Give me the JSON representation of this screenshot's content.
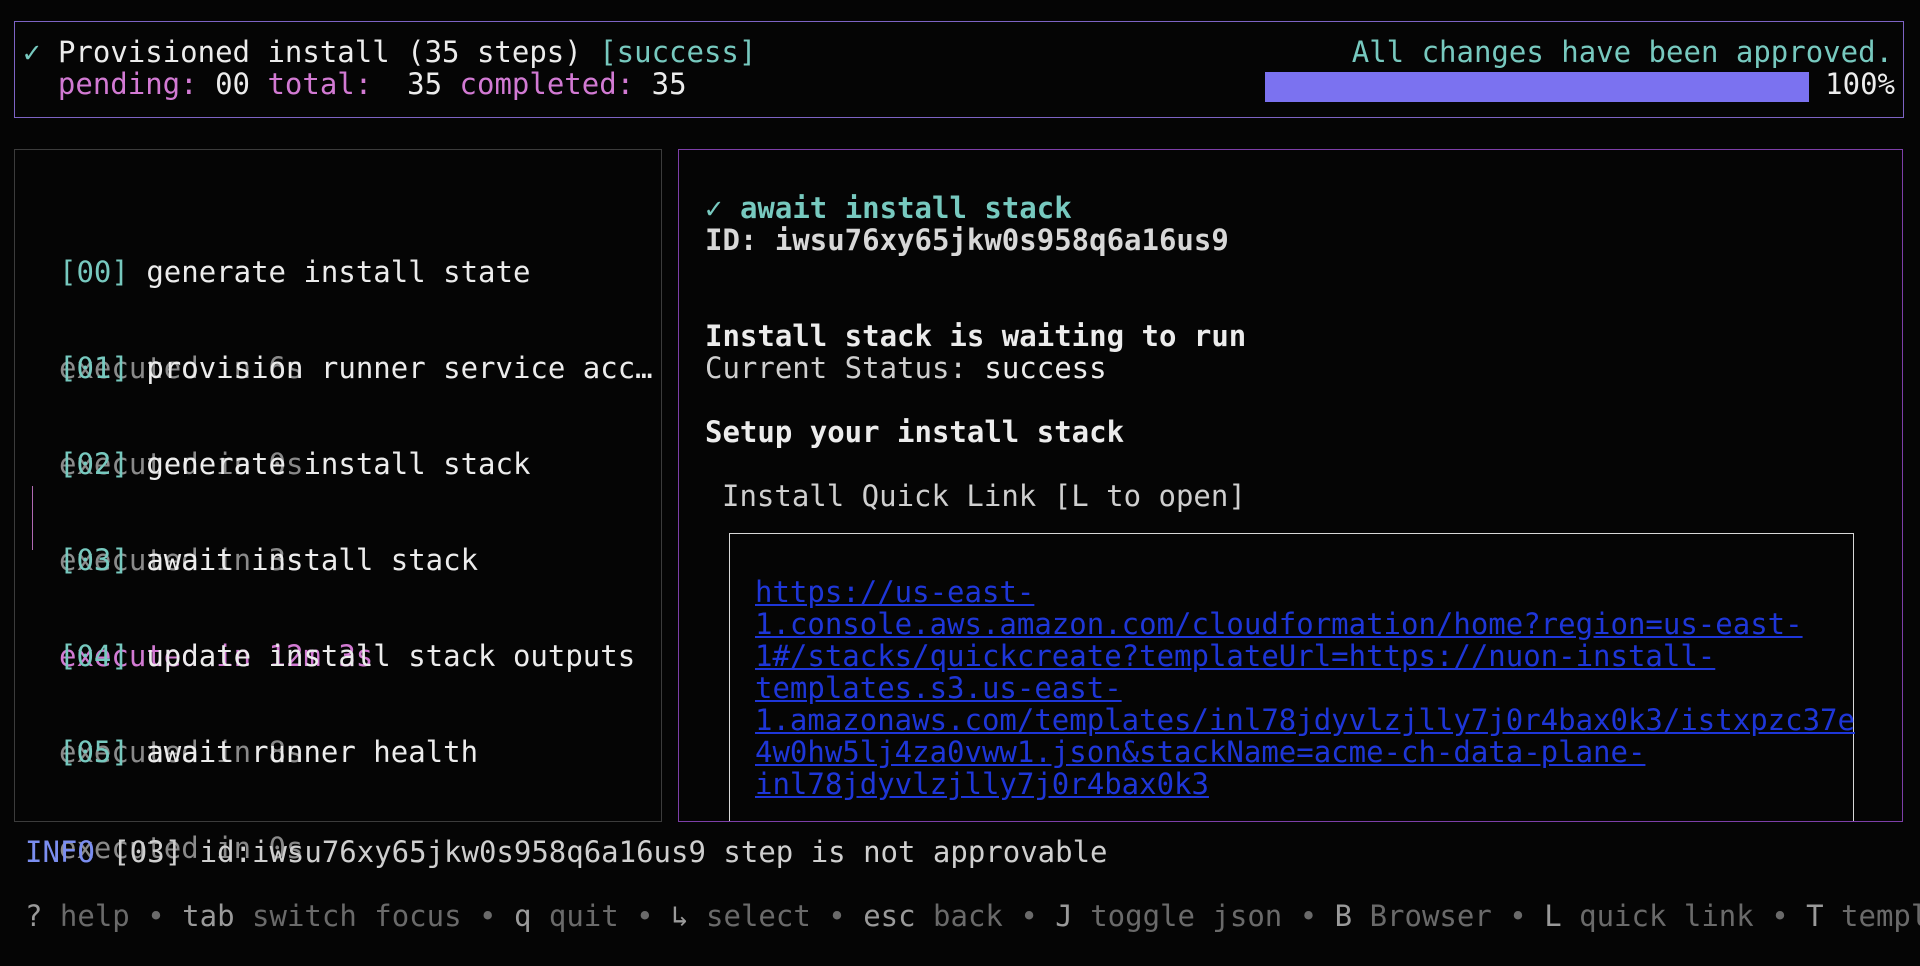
{
  "header": {
    "check": "✓",
    "title": "Provisioned install (35 steps)",
    "status": "[success]",
    "pending_label": "pending:",
    "pending_value": "00",
    "total_label": "total:",
    "total_value": "35",
    "completed_label": "completed:",
    "completed_value": "35",
    "approved_text": "All changes have been approved.",
    "progress": 100,
    "progress_label": "100%"
  },
  "steps": [
    {
      "index": "[00]",
      "title": "generate install state",
      "status": "executed in 6s"
    },
    {
      "index": "[01]",
      "title": "provision runner service acc…",
      "status": "executed in 0s"
    },
    {
      "index": "[02]",
      "title": "generate install stack",
      "status": "executed in 3s"
    },
    {
      "index": "[03]",
      "title": "await install stack",
      "status": "executed in 12m 3s",
      "selected": true
    },
    {
      "index": "[04]",
      "title": "update install stack outputs",
      "status": "executed in 8s"
    },
    {
      "index": "[05]",
      "title": "await runner health",
      "status": "executed in 0s"
    }
  ],
  "detail": {
    "check": "✓",
    "title": "await install stack",
    "id_line": "ID: iwsu76xy65jkw0s958q6a16us9",
    "waiting_title": "Install stack is waiting to run",
    "current_status_label": "Current Status:",
    "current_status_value": "success",
    "setup_title": "Setup your install stack",
    "quick_link_label": "Install Quick Link [L to open]",
    "quick_link_url": "https://us-east-\n1.console.aws.amazon.com/cloudformation/home?region=us-east-\n1#/stacks/quickcreate?templateUrl=https://nuon-install-\ntemplates.s3.us-east-\n1.amazonaws.com/templates/inl78jdyvlzjlly7j0r4bax0k3/istxpzc37e\n4w0hw5lj4za0vww1.json&stackName=acme-ch-data-plane-\ninl78jdyvlzjlly7j0r4bax0k3"
  },
  "info": {
    "level": "INFO",
    "message": "[03] id:iwsu76xy65jkw0s958q6a16us9 step is not approvable"
  },
  "help": [
    {
      "key": "?",
      "label": "help"
    },
    {
      "key": "tab",
      "label": "switch focus"
    },
    {
      "key": "q",
      "label": "quit"
    },
    {
      "key": "↳",
      "label": "select"
    },
    {
      "key": "esc",
      "label": "back"
    },
    {
      "key": "J",
      "label": "toggle json"
    },
    {
      "key": "B",
      "label": "Browser"
    },
    {
      "key": "L",
      "label": "quick link"
    },
    {
      "key": "T",
      "label": "templ"
    }
  ],
  "help_separator": "•",
  "colors": {
    "accent_purple": "#7d63c4",
    "teal": "#77c9bf",
    "magenta": "#d27ad3",
    "progress": "#7b72f0",
    "link": "#1e36d8"
  }
}
